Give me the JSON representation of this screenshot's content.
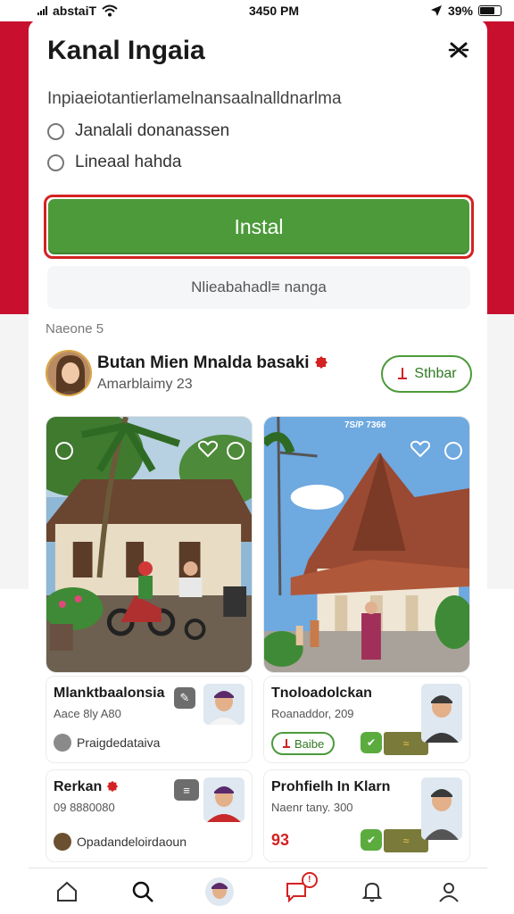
{
  "status_bar": {
    "carrier": "abstaiT",
    "time": "3450 PM",
    "battery": "39%"
  },
  "sheet": {
    "title": "Kanal Ingaia",
    "close_icon": "close-icon",
    "permission_line": "Inpiaeiotantierlamelnansaalnalldnarlma",
    "options": [
      {
        "label": "Janalali donanassen"
      },
      {
        "label": "Lineaal hahda"
      }
    ],
    "install_label": "Instal",
    "secondary_label": "Nlieabahadl≡ nanga"
  },
  "section": {
    "label": "Naeone 5"
  },
  "profile": {
    "name": "Butan Mien Mnalda basaki",
    "subtitle": "Amarblaimy 23",
    "follow_label": "Sthbar"
  },
  "cards": [
    {
      "title": "Mlanktbaalonsia",
      "subtitle": "Aace 8ly A80",
      "foot": "Praigdedataiva"
    },
    {
      "photo_time": "7S/P 7366",
      "title": "Tnoloadolckan",
      "subtitle": "Roanaddor, 209",
      "pill_label": "Baibe"
    },
    {
      "title": "Rerkan",
      "subtitle": "09 8880080",
      "foot": "Opadandeloirdaoun"
    },
    {
      "title": "Prohfielh In Klarn",
      "subtitle": "Naenr tany. 300",
      "foot": "93"
    }
  ],
  "tabbar": {
    "items": [
      "home-icon",
      "search-icon",
      "profile-avatar",
      "chat-icon",
      "bell-icon",
      "user-icon"
    ],
    "chat_badge": "!"
  },
  "colors": {
    "brand_red": "#c8102e",
    "install_green": "#4c9a3a",
    "highlight_red": "#d42222"
  }
}
